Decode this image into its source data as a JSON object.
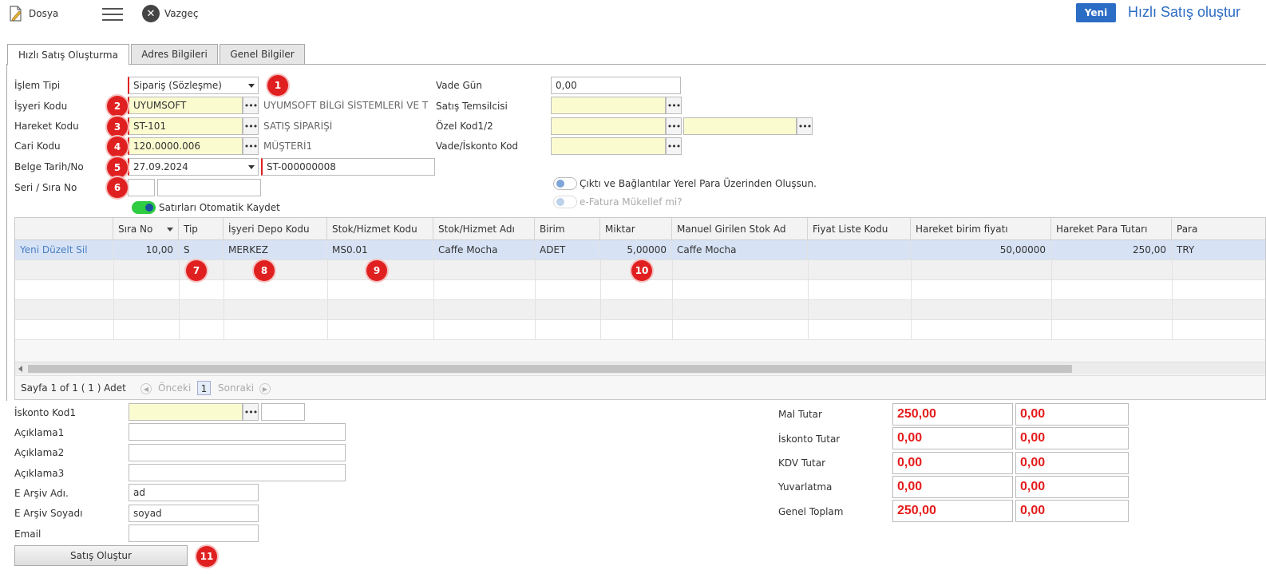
{
  "toolbar": {
    "dosya_label": "Dosya",
    "vazgec_label": "Vazgeç",
    "yeni_label": "Yeni",
    "title": "Hızlı Satış oluştur"
  },
  "tabs": [
    {
      "label": "Hızlı Satış Oluşturma",
      "active": true
    },
    {
      "label": "Adres Bilgileri",
      "active": false
    },
    {
      "label": "Genel Bilgiler",
      "active": false
    }
  ],
  "form": {
    "islem_tipi": {
      "label": "İşlem Tipi",
      "value": "Sipariş (Sözleşme)"
    },
    "isyeri_kodu": {
      "label": "İşyeri Kodu",
      "value": "UYUMSOFT",
      "desc": "UYUMSOFT BİLGİ SİSTEMLERİ VE T"
    },
    "hareket_kodu": {
      "label": "Hareket Kodu",
      "value": "ST-101",
      "desc": "SATIŞ SİPARİŞİ"
    },
    "cari_kodu": {
      "label": "Cari Kodu",
      "value": "120.0000.006",
      "desc": "MÜŞTERİ1"
    },
    "belge_tarih": {
      "label": "Belge Tarih/No",
      "date": "27.09.2024",
      "no": "ST-000000008"
    },
    "seri_sira": {
      "label": "Seri / Sıra No",
      "seri": "",
      "sira": ""
    },
    "satirlari_kaydet": {
      "label": "Satırları Otomatik Kaydet",
      "on": true
    },
    "vade_gun": {
      "label": "Vade Gün",
      "value": "0,00"
    },
    "satis_temsilcisi": {
      "label": "Satış Temsilcisi",
      "value": ""
    },
    "ozel_kod": {
      "label": "Özel Kod1/2",
      "value1": "",
      "value2": ""
    },
    "vade_iskonto": {
      "label": "Vade/İskonto Kod",
      "value": ""
    },
    "cikti_toggle": {
      "label": "Çıktı ve Bağlantılar Yerel Para Üzerinden Oluşsun.",
      "on": false
    },
    "efatura_toggle": {
      "label": "e-Fatura Mükellef mi?",
      "on": false
    }
  },
  "badges": [
    "1",
    "2",
    "3",
    "4",
    "5",
    "6",
    "7",
    "8",
    "9",
    "10",
    "11"
  ],
  "grid": {
    "columns": [
      "",
      "Sıra No",
      "Tip",
      "İşyeri Depo Kodu",
      "Stok/Hizmet Kodu",
      "Stok/Hizmet Adı",
      "Birim",
      "Miktar",
      "Manuel Girilen Stok Ad",
      "Fiyat Liste Kodu",
      "Hareket birim fiyatı",
      "Hareket Para Tutarı",
      "Para"
    ],
    "rows": [
      {
        "commands": "Yeni Düzelt Sil",
        "sira_no": "10,00",
        "tip": "S",
        "depo": "MERKEZ",
        "stok_kodu": "MS0.01",
        "stok_adi": "Caffe Mocha",
        "birim": "ADET",
        "miktar": "5,00000",
        "manuel_ad": "Caffe Mocha",
        "fiyat_liste": "",
        "birim_fiyat": "50,00000",
        "para_tutari": "250,00",
        "para": "TRY"
      }
    ],
    "pager": {
      "text": "Sayfa 1 of 1 ( 1 ) Adet",
      "prev": "Önceki",
      "page": "1",
      "next": "Sonraki"
    }
  },
  "bottom": {
    "iskonto_kod1": {
      "label": "İskonto Kod1",
      "value": "",
      "value2": ""
    },
    "aciklama1": {
      "label": "Açıklama1",
      "value": ""
    },
    "aciklama2": {
      "label": "Açıklama2",
      "value": ""
    },
    "aciklama3": {
      "label": "Açıklama3",
      "value": ""
    },
    "earsiv_adi": {
      "label": "E Arşiv Adı.",
      "value": "ad"
    },
    "earsiv_soyadi": {
      "label": "E Arşiv Soyadı",
      "value": "soyad"
    },
    "email": {
      "label": "Email",
      "value": ""
    },
    "satis_olustur": "Satış Oluştur"
  },
  "totals": [
    {
      "label": "Mal Tutar",
      "value1": "250,00",
      "value2": "0,00"
    },
    {
      "label": "İskonto Tutar",
      "value1": "0,00",
      "value2": "0,00"
    },
    {
      "label": "KDV Tutar",
      "value1": "0,00",
      "value2": "0,00"
    },
    {
      "label": "Yuvarlatma",
      "value1": "0,00",
      "value2": "0,00"
    },
    {
      "label": "Genel Toplam",
      "value1": "250,00",
      "value2": "0,00"
    }
  ],
  "colors": {
    "accent": "#2b6cc4",
    "required": "#e02020",
    "total_red": "#e51c1c",
    "lookup_yellow": "#fbfbd0"
  }
}
